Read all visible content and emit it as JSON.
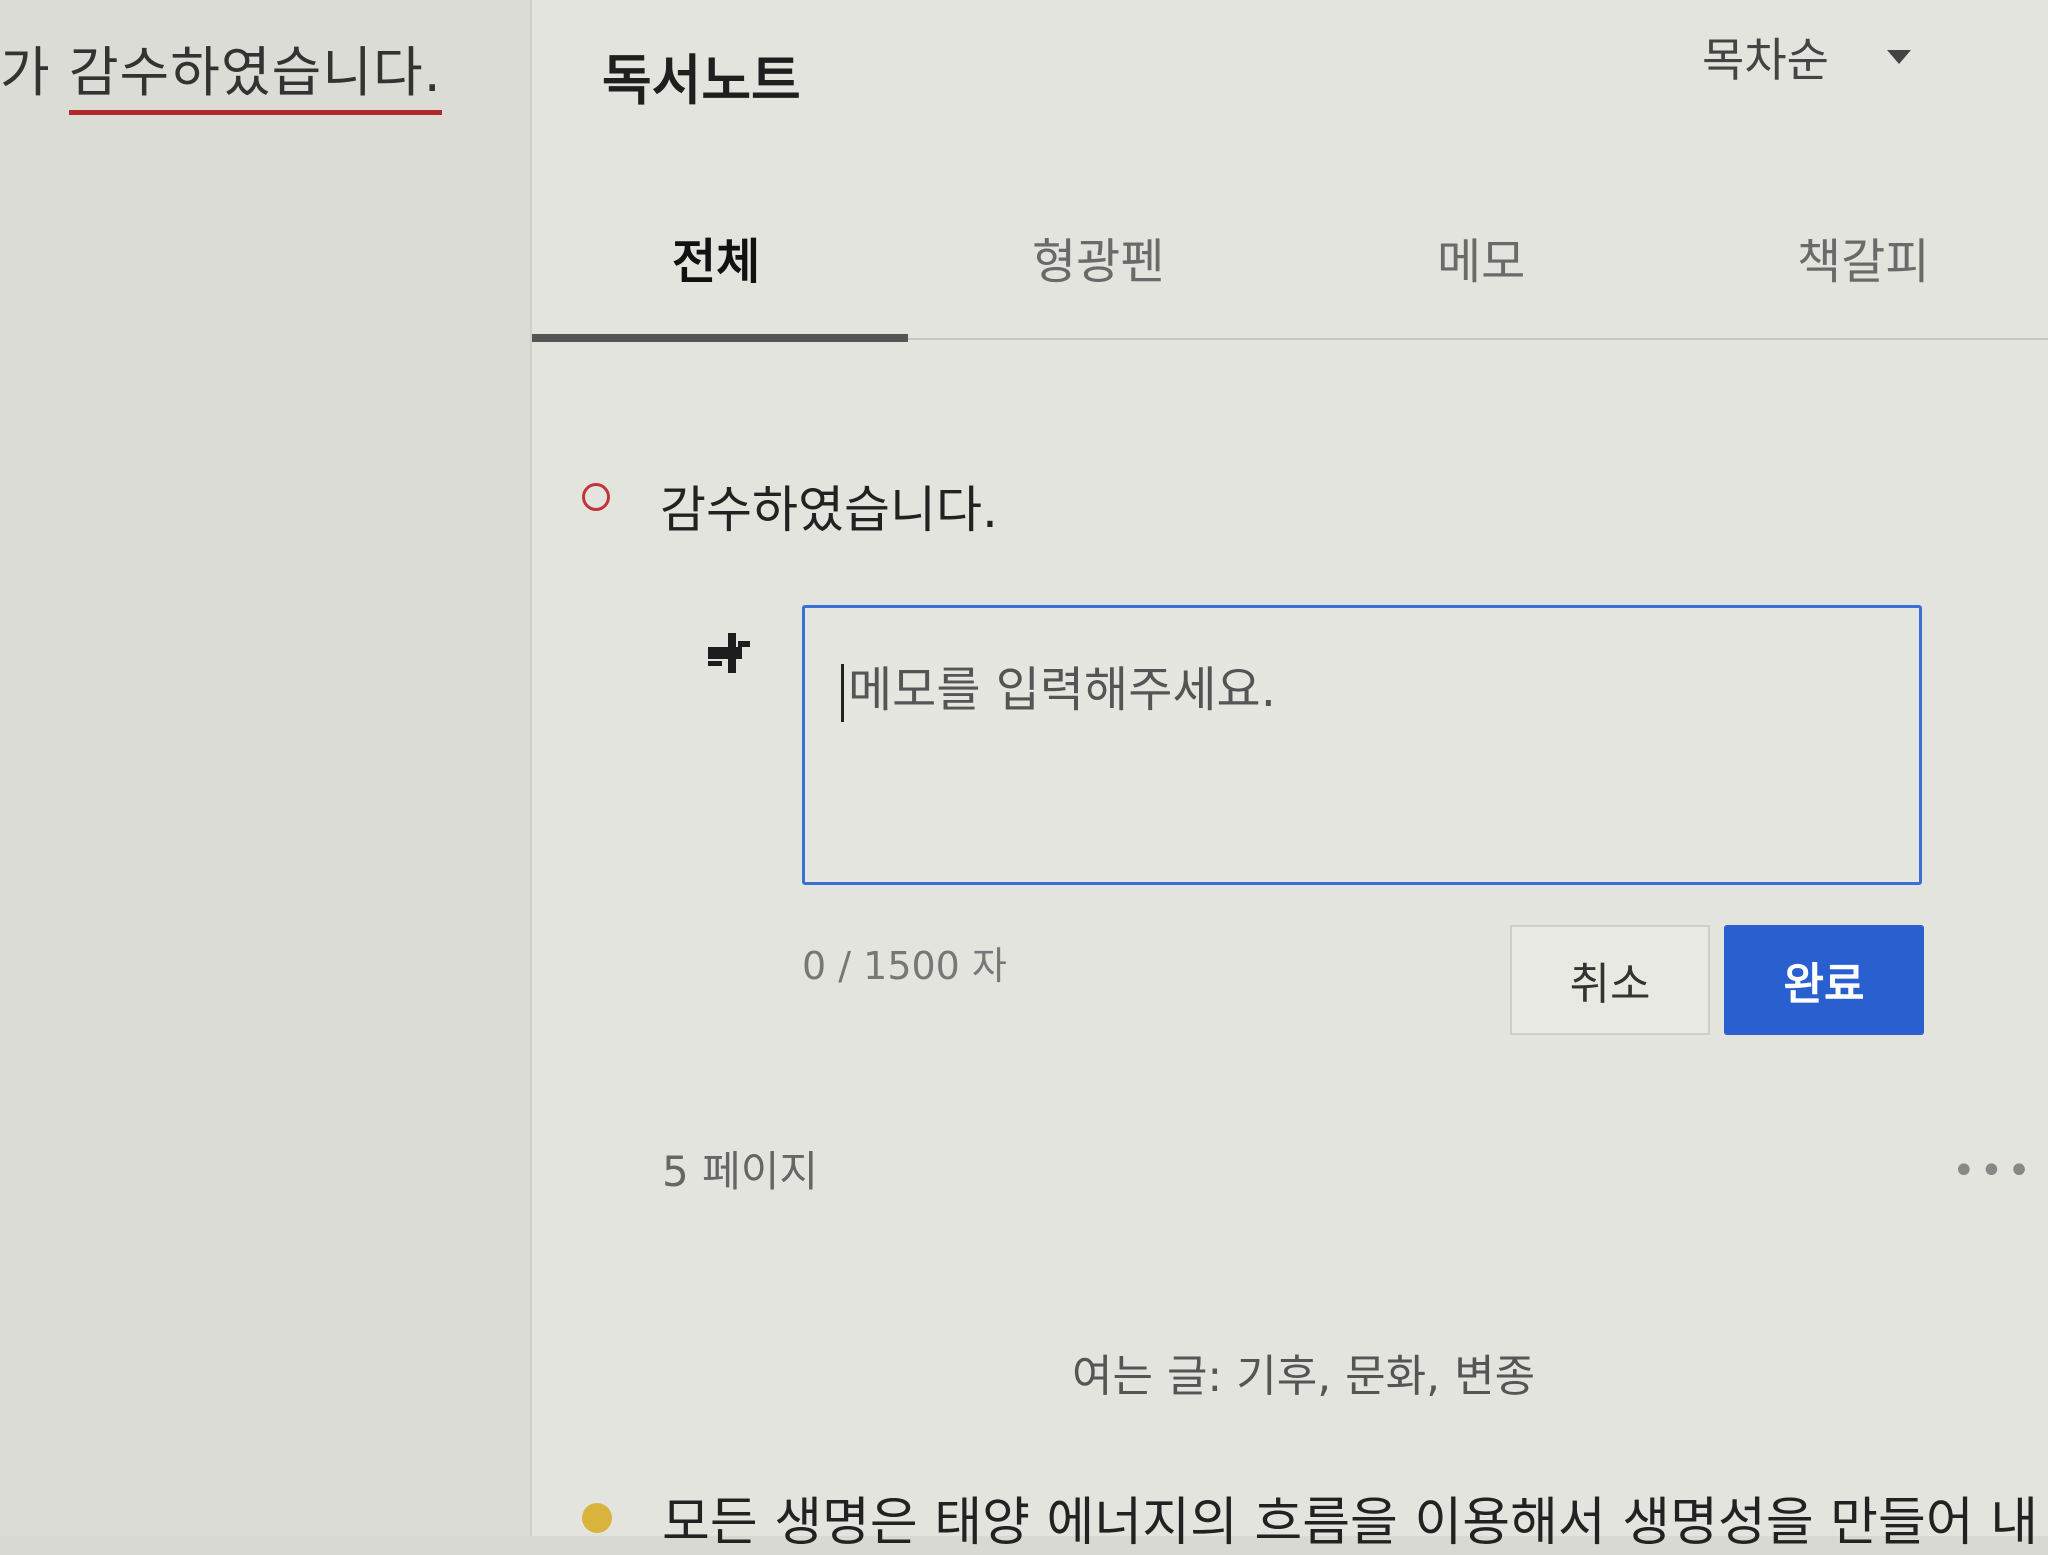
{
  "reader": {
    "line_prefix": "가 ",
    "line_highlight": "감수하였습니다."
  },
  "panel": {
    "title": "독서노트",
    "toc_label": "목차순"
  },
  "tabs": [
    {
      "label": "전체"
    },
    {
      "label": "형광펜"
    },
    {
      "label": "메모"
    },
    {
      "label": "책갈피"
    }
  ],
  "note": {
    "quote": "감수하였습니다.",
    "memo_placeholder": "메모를 입력해주세요.",
    "char_count": "0 / 1500 자",
    "cancel_label": "취소",
    "done_label": "완료",
    "page_ref": "5 페이지",
    "more": "•••"
  },
  "chapter": {
    "heading": "여는 글: 기후, 문화, 변종"
  },
  "next_item": {
    "text": "모든 생명은 태양 에너지의 흐름을 이용해서 생명성을 만들어 내"
  },
  "colors": {
    "accent": "#2a5fd0",
    "highlight_red": "#c0343a",
    "highlight_yellow": "#d9b43c"
  }
}
